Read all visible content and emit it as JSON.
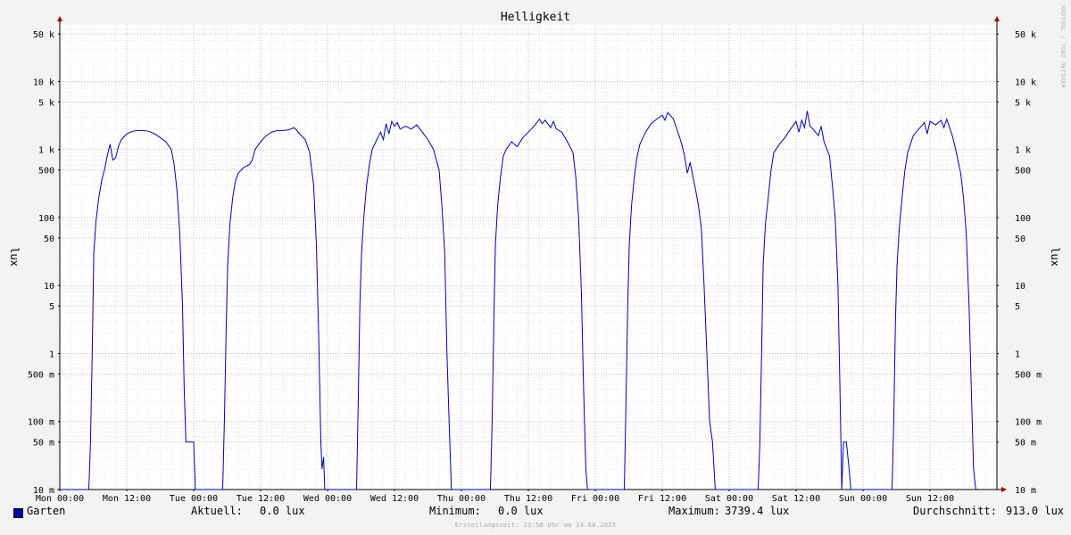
{
  "chart_data": {
    "type": "line",
    "title": "Helligkeit",
    "ylabel": "lux",
    "ylabel_right": "lux",
    "yscale": "log",
    "ylim": [
      0.01,
      70000
    ],
    "xlim": [
      "Mon 00:00",
      "Mon 00:00 (+7d)"
    ],
    "x_unit": "hours since Mon 00:00",
    "x_ticks": [
      "Mon 00:00",
      "Mon 12:00",
      "Tue 00:00",
      "Tue 12:00",
      "Wed 00:00",
      "Wed 12:00",
      "Thu 00:00",
      "Thu 12:00",
      "Fri 00:00",
      "Fri 12:00",
      "Sat 00:00",
      "Sat 12:00",
      "Sun 00:00",
      "Sun 12:00"
    ],
    "y_ticks": [
      {
        "v": 50000,
        "label": "50 k"
      },
      {
        "v": 10000,
        "label": "10 k"
      },
      {
        "v": 5000,
        "label": "5 k"
      },
      {
        "v": 1000,
        "label": "1 k"
      },
      {
        "v": 500,
        "label": "500"
      },
      {
        "v": 100,
        "label": "100"
      },
      {
        "v": 50,
        "label": "50"
      },
      {
        "v": 10,
        "label": "10"
      },
      {
        "v": 5,
        "label": "5"
      },
      {
        "v": 1,
        "label": "1"
      },
      {
        "v": 0.5,
        "label": "500 m"
      },
      {
        "v": 0.1,
        "label": "100 m"
      },
      {
        "v": 0.05,
        "label": "50 m"
      },
      {
        "v": 0.01,
        "label": "10 m"
      }
    ],
    "grid": true,
    "legend_position": "bottom-left",
    "series": [
      {
        "name": "Garten",
        "color": "#0000aa",
        "points": [
          [
            0,
            0.01
          ],
          [
            5.2,
            0.01
          ],
          [
            5.5,
            0.05
          ],
          [
            5.8,
            1
          ],
          [
            6.1,
            30
          ],
          [
            6.5,
            90
          ],
          [
            7.0,
            200
          ],
          [
            7.5,
            350
          ],
          [
            8.0,
            500
          ],
          [
            8.5,
            800
          ],
          [
            9.0,
            1200
          ],
          [
            9.5,
            700
          ],
          [
            10.0,
            750
          ],
          [
            10.5,
            1100
          ],
          [
            11,
            1400
          ],
          [
            12,
            1700
          ],
          [
            13,
            1850
          ],
          [
            14,
            1900
          ],
          [
            15,
            1900
          ],
          [
            16,
            1850
          ],
          [
            17,
            1700
          ],
          [
            18,
            1500
          ],
          [
            19,
            1300
          ],
          [
            20,
            1000
          ],
          [
            20.5,
            600
          ],
          [
            21,
            250
          ],
          [
            21.5,
            60
          ],
          [
            22,
            5
          ],
          [
            22.3,
            0.3
          ],
          [
            22.6,
            0.05
          ],
          [
            23,
            0.05
          ],
          [
            24,
            0.05
          ],
          [
            24.3,
            0.01
          ],
          [
            29.2,
            0.01
          ],
          [
            29.5,
            0.1
          ],
          [
            29.8,
            2
          ],
          [
            30.1,
            20
          ],
          [
            30.5,
            80
          ],
          [
            31,
            200
          ],
          [
            31.5,
            350
          ],
          [
            32,
            450
          ],
          [
            33,
            550
          ],
          [
            34,
            600
          ],
          [
            34.5,
            700
          ],
          [
            35,
            1000
          ],
          [
            36,
            1300
          ],
          [
            37,
            1600
          ],
          [
            38,
            1800
          ],
          [
            39,
            1900
          ],
          [
            40,
            1900
          ],
          [
            41,
            1950
          ],
          [
            42,
            2100
          ],
          [
            43,
            1700
          ],
          [
            44,
            1400
          ],
          [
            44.8,
            900
          ],
          [
            45.5,
            300
          ],
          [
            46,
            40
          ],
          [
            46.4,
            2
          ],
          [
            46.8,
            0.05
          ],
          [
            47,
            0.02
          ],
          [
            47.3,
            0.03
          ],
          [
            47.5,
            0.01
          ],
          [
            53.2,
            0.01
          ],
          [
            53.5,
            0.2
          ],
          [
            53.8,
            5
          ],
          [
            54.1,
            30
          ],
          [
            54.5,
            100
          ],
          [
            55,
            300
          ],
          [
            55.5,
            600
          ],
          [
            56,
            1000
          ],
          [
            57,
            1500
          ],
          [
            57.5,
            1800
          ],
          [
            58,
            1400
          ],
          [
            58.5,
            2400
          ],
          [
            59,
            1700
          ],
          [
            59.5,
            2600
          ],
          [
            60,
            2200
          ],
          [
            60.5,
            2500
          ],
          [
            61,
            2000
          ],
          [
            62,
            2200
          ],
          [
            63,
            2000
          ],
          [
            64,
            2300
          ],
          [
            65,
            1800
          ],
          [
            66,
            1400
          ],
          [
            67,
            1000
          ],
          [
            68,
            500
          ],
          [
            68.5,
            150
          ],
          [
            69,
            30
          ],
          [
            69.4,
            1
          ],
          [
            69.8,
            0.1
          ],
          [
            70.2,
            0.01
          ],
          [
            77.2,
            0.01
          ],
          [
            77.5,
            0.1
          ],
          [
            77.8,
            3
          ],
          [
            78.1,
            40
          ],
          [
            78.5,
            150
          ],
          [
            79,
            400
          ],
          [
            79.5,
            800
          ],
          [
            80,
            1000
          ],
          [
            81,
            1300
          ],
          [
            82,
            1100
          ],
          [
            83,
            1500
          ],
          [
            84,
            1800
          ],
          [
            85,
            2200
          ],
          [
            86,
            2800
          ],
          [
            86.5,
            2400
          ],
          [
            87,
            2700
          ],
          [
            88,
            2100
          ],
          [
            88.5,
            2600
          ],
          [
            89,
            2000
          ],
          [
            90,
            1800
          ],
          [
            91,
            1300
          ],
          [
            92,
            900
          ],
          [
            92.5,
            400
          ],
          [
            93,
            100
          ],
          [
            93.5,
            8
          ],
          [
            93.9,
            0.3
          ],
          [
            94.3,
            0.02
          ],
          [
            94.6,
            0.01
          ],
          [
            101.2,
            0.01
          ],
          [
            101.5,
            0.2
          ],
          [
            101.8,
            5
          ],
          [
            102.1,
            40
          ],
          [
            102.5,
            150
          ],
          [
            103,
            400
          ],
          [
            103.5,
            800
          ],
          [
            104,
            1200
          ],
          [
            105,
            1800
          ],
          [
            106,
            2400
          ],
          [
            107,
            2800
          ],
          [
            108,
            3200
          ],
          [
            108.5,
            2700
          ],
          [
            109,
            3500
          ],
          [
            110,
            2800
          ],
          [
            111,
            1600
          ],
          [
            111.5,
            1200
          ],
          [
            112,
            800
          ],
          [
            112.5,
            450
          ],
          [
            113,
            650
          ],
          [
            113.5,
            400
          ],
          [
            114,
            250
          ],
          [
            114.5,
            150
          ],
          [
            115,
            70
          ],
          [
            115.5,
            10
          ],
          [
            116,
            1
          ],
          [
            116.5,
            0.1
          ],
          [
            117,
            0.05
          ],
          [
            117.5,
            0.01
          ],
          [
            125.2,
            0.01
          ],
          [
            125.5,
            0.05
          ],
          [
            125.8,
            1
          ],
          [
            126.1,
            20
          ],
          [
            126.5,
            80
          ],
          [
            127,
            200
          ],
          [
            127.5,
            500
          ],
          [
            128,
            900
          ],
          [
            129,
            1200
          ],
          [
            130,
            1500
          ],
          [
            131,
            2000
          ],
          [
            132,
            2600
          ],
          [
            132.5,
            1800
          ],
          [
            133,
            2700
          ],
          [
            133.5,
            2100
          ],
          [
            134,
            3700
          ],
          [
            134.5,
            2200
          ],
          [
            135,
            2000
          ],
          [
            136,
            1600
          ],
          [
            136.5,
            2200
          ],
          [
            137,
            1300
          ],
          [
            138,
            800
          ],
          [
            138.5,
            300
          ],
          [
            139,
            100
          ],
          [
            139.5,
            10
          ],
          [
            139.8,
            0.5
          ],
          [
            140.2,
            0.01
          ],
          [
            140.5,
            0.05
          ],
          [
            141,
            0.05
          ],
          [
            141.5,
            0.02
          ],
          [
            141.8,
            0.01
          ],
          [
            149.2,
            0.01
          ],
          [
            149.5,
            0.1
          ],
          [
            149.8,
            3
          ],
          [
            150.1,
            20
          ],
          [
            150.5,
            70
          ],
          [
            151,
            200
          ],
          [
            151.5,
            500
          ],
          [
            152,
            900
          ],
          [
            152.5,
            1200
          ],
          [
            153,
            1600
          ],
          [
            154,
            2000
          ],
          [
            155,
            2500
          ],
          [
            155.5,
            1700
          ],
          [
            156,
            2600
          ],
          [
            157,
            2300
          ],
          [
            158,
            2700
          ],
          [
            158.5,
            2100
          ],
          [
            159,
            2800
          ],
          [
            160,
            1600
          ],
          [
            160.5,
            1100
          ],
          [
            161,
            700
          ],
          [
            161.5,
            450
          ],
          [
            162,
            200
          ],
          [
            162.5,
            60
          ],
          [
            163,
            5
          ],
          [
            163.4,
            0.3
          ],
          [
            163.8,
            0.02
          ],
          [
            164.2,
            0.01
          ]
        ]
      }
    ],
    "stats": {
      "aktuell_label": "Aktuell:",
      "aktuell_value": "0.0 lux",
      "minimum_label": "Minimum:",
      "minimum_value": "0.0 lux",
      "maximum_label": "Maximum:",
      "maximum_value": "3739.4 lux",
      "average_label": "Durchschnitt:",
      "average_value": "913.0 lux"
    },
    "footer": "Erstellungszeit: 23:58 Uhr am 24.08.2025",
    "watermark": "RRDTOOL / TOBI OETIKER",
    "colors": {
      "background": "#f3f3f3",
      "plot_background": "#ffffff",
      "major_grid": "#e89a9a",
      "minor_grid": "#d8d8d8",
      "line": "#0000aa",
      "axis_arrow": "#a00000"
    }
  }
}
